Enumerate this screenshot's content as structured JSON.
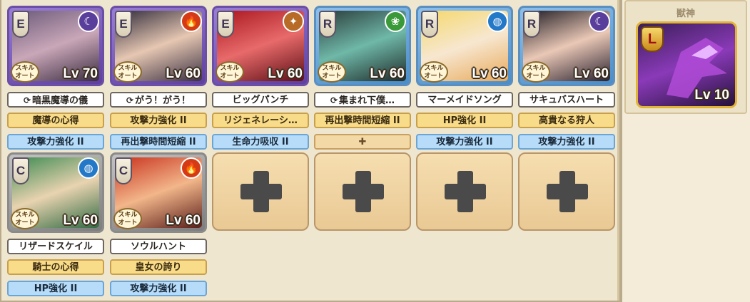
{
  "units": [
    {
      "rank": "E",
      "element": "dark",
      "element_icon": "☾",
      "level": "Lv 70",
      "skill": "暗黒魔導の儀",
      "skill_cycle": true,
      "ability1": "魔導の心得",
      "ability2": "攻撃力強化 II",
      "art": "linear-gradient(160deg,#6b5a7a,#c9a7b8,#3a2c40)"
    },
    {
      "rank": "E",
      "element": "fire",
      "element_icon": "🔥",
      "level": "Lv 60",
      "skill": "がう！がう！",
      "skill_cycle": true,
      "ability1": "攻撃力強化 II",
      "ability2": "再出撃時間短縮 II",
      "art": "linear-gradient(160deg,#2f2a3a,#e6c7b2,#3a3042)"
    },
    {
      "rank": "E",
      "element": "earth",
      "element_icon": "✦",
      "level": "Lv 60",
      "skill": "ビッグパンチ",
      "skill_cycle": false,
      "ability1": "リジェネレーシ…",
      "ability2": "生命力吸収 II",
      "art": "linear-gradient(160deg,#a8161e,#e86a6a,#5a0f16)"
    },
    {
      "rank": "R",
      "element": "wind",
      "element_icon": "❀",
      "level": "Lv 60",
      "skill": "集まれ下僕…",
      "skill_cycle": true,
      "ability1": "再出撃時間短縮 II",
      "ability2": "",
      "art": "linear-gradient(160deg,#2a3a3a,#6fb8a8,#1e2a2a)"
    },
    {
      "rank": "R",
      "element": "water",
      "element_icon": "◍",
      "level": "Lv 60",
      "skill": "マーメイドソング",
      "skill_cycle": false,
      "ability1": "HP強化 II",
      "ability2": "攻撃力強化 II",
      "art": "linear-gradient(160deg,#f5d86a,#f7e7d0,#e8a95a)"
    },
    {
      "rank": "R",
      "element": "dark",
      "element_icon": "☾",
      "level": "Lv 60",
      "skill": "サキュバスハート",
      "skill_cycle": false,
      "ability1": "高貴なる狩人",
      "ability2": "攻撃力強化 II",
      "art": "linear-gradient(160deg,#1e1a22,#eac8b6,#2a2230)"
    },
    {
      "rank": "C",
      "element": "water",
      "element_icon": "◍",
      "level": "Lv 60",
      "skill": "リザードスケイル",
      "skill_cycle": false,
      "ability1": "騎士の心得",
      "ability2": "HP強化 II",
      "art": "linear-gradient(160deg,#3c8a52,#e9d3b0,#2e6a42)"
    },
    {
      "rank": "C",
      "element": "fire",
      "element_icon": "🔥",
      "level": "Lv 60",
      "skill": "ソウルハント",
      "skill_cycle": false,
      "ability1": "皇女の誇り",
      "ability2": "攻撃力強化 II",
      "art": "linear-gradient(160deg,#c8321e,#f2b68a,#5a1e1a)"
    }
  ],
  "badge_text": "スキル\nオート",
  "empty_slots": 4,
  "beast": {
    "title": "獣神",
    "rank": "L",
    "level": "Lv 10"
  }
}
